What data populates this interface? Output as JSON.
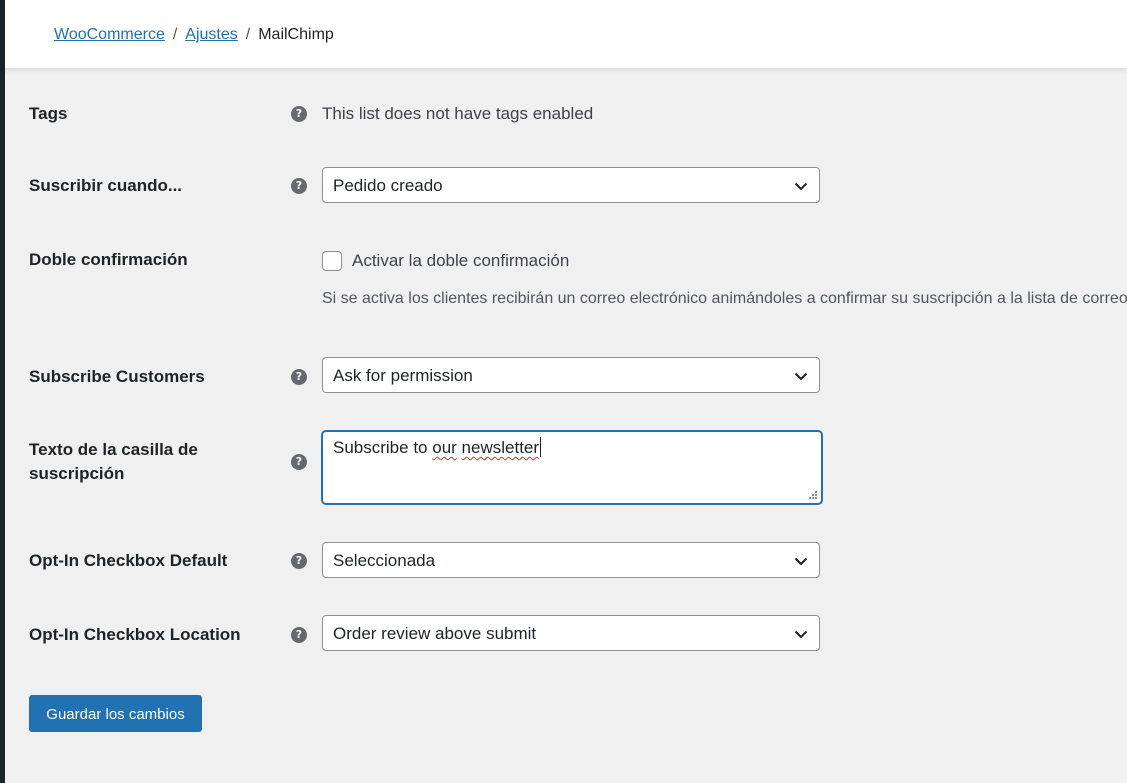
{
  "breadcrumb": {
    "woocommerce": "WooCommerce",
    "ajustes": "Ajustes",
    "current": "MailChimp",
    "separator": "/"
  },
  "form": {
    "tags": {
      "label": "Tags",
      "value": "This list does not have tags enabled"
    },
    "subscribe_when": {
      "label": "Suscribir cuando...",
      "value": "Pedido creado"
    },
    "double_optin": {
      "label": "Doble confirmación",
      "checkbox_label": "Activar la doble confirmación",
      "checked": false,
      "description": "Si se activa los clientes recibirán un correo electrónico animándoles a confirmar su suscripción a la lista de correo"
    },
    "subscribe_customers": {
      "label": "Subscribe Customers",
      "value": "Ask for permission"
    },
    "checkbox_text": {
      "label_line1": "Texto de la casilla de",
      "label_line2": "suscripción",
      "value_part1": "Subscribe to ",
      "value_misspelled1": "our",
      "value_space": " ",
      "value_misspelled2": "newsletter"
    },
    "optin_default": {
      "label": "Opt-In Checkbox Default",
      "value": "Seleccionada"
    },
    "optin_location": {
      "label": "Opt-In Checkbox Location",
      "value": "Order review above submit"
    }
  },
  "save_button": "Guardar los cambios",
  "icons": {
    "help": "help-icon",
    "chevron": "chevron-down-icon",
    "resize": "resize-grip-icon"
  },
  "colors": {
    "accent": "#2271b1",
    "background": "#f0f0f1",
    "help_icon": "#646970",
    "spellcheck": "#d63638"
  }
}
